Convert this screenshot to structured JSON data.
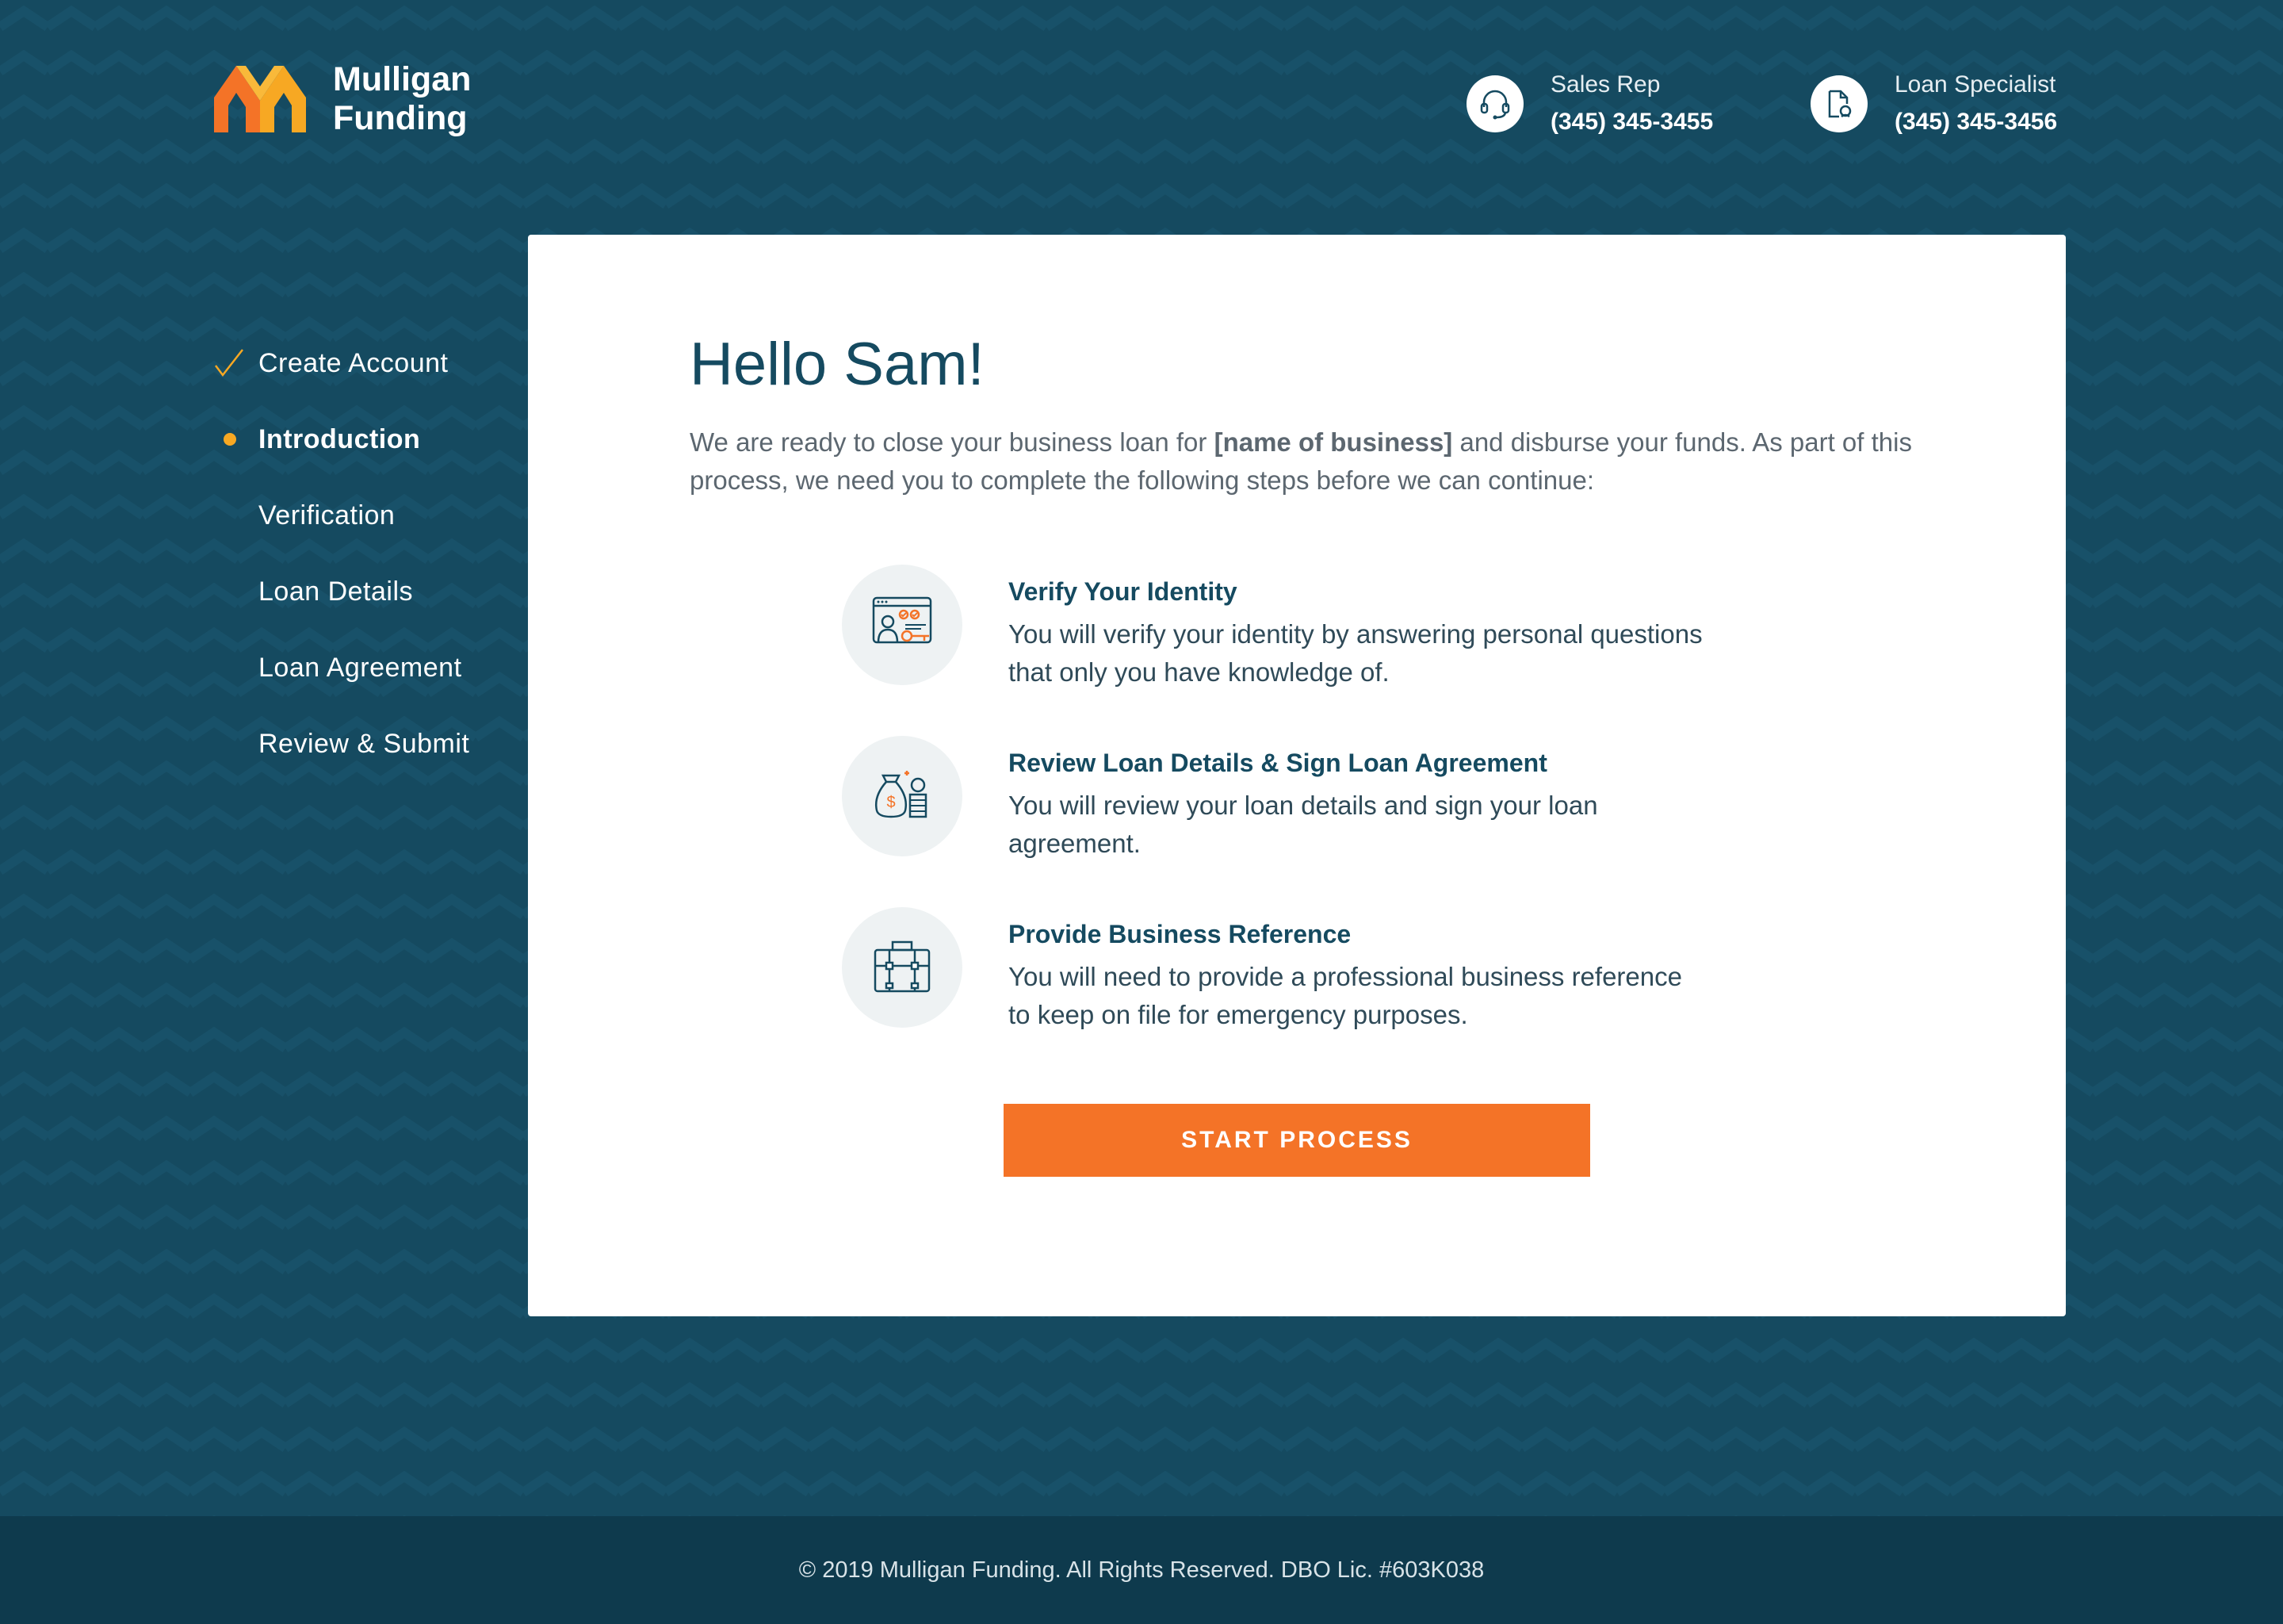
{
  "brand": {
    "name_line1": "Mulligan",
    "name_line2": "Funding",
    "colors": {
      "navy": "#154a60",
      "orange": "#f47327",
      "yellow": "#f7a823",
      "footer": "#0e3a4d"
    }
  },
  "header": {
    "contacts": [
      {
        "label": "Sales Rep",
        "phone": "(345) 345-3455",
        "icon": "headset-icon"
      },
      {
        "label": "Loan Specialist",
        "phone": "(345) 345-3456",
        "icon": "document-search-icon"
      }
    ]
  },
  "sidebar": {
    "steps": [
      {
        "label": "Create Account",
        "status": "complete"
      },
      {
        "label": "Introduction",
        "status": "active"
      },
      {
        "label": "Verification",
        "status": "pending"
      },
      {
        "label": "Loan Details",
        "status": "pending"
      },
      {
        "label": "Loan Agreement",
        "status": "pending"
      },
      {
        "label": "Review & Submit",
        "status": "pending"
      }
    ]
  },
  "main": {
    "greeting": "Hello Sam!",
    "intro_before": "We are ready to close your business loan for ",
    "intro_business": "[name of business]",
    "intro_after": " and disburse your funds. As part of this process, we need you to complete the following steps before we can continue:",
    "tasks": [
      {
        "title": "Verify Your Identity",
        "description": "You will verify your identity by answering personal questions that only you have knowledge of.",
        "icon": "identity-verification-icon"
      },
      {
        "title": "Review Loan Details & Sign Loan Agreement",
        "description": "You will review your loan details and sign your loan agreement.",
        "icon": "money-bag-icon"
      },
      {
        "title": "Provide Business Reference",
        "description": "You will need to provide a professional business reference to keep on file for emergency purposes.",
        "icon": "briefcase-icon"
      }
    ],
    "cta_label": "START PROCESS"
  },
  "footer": {
    "text": "© 2019 Mulligan Funding. All Rights Reserved. DBO Lic. #603K038"
  }
}
